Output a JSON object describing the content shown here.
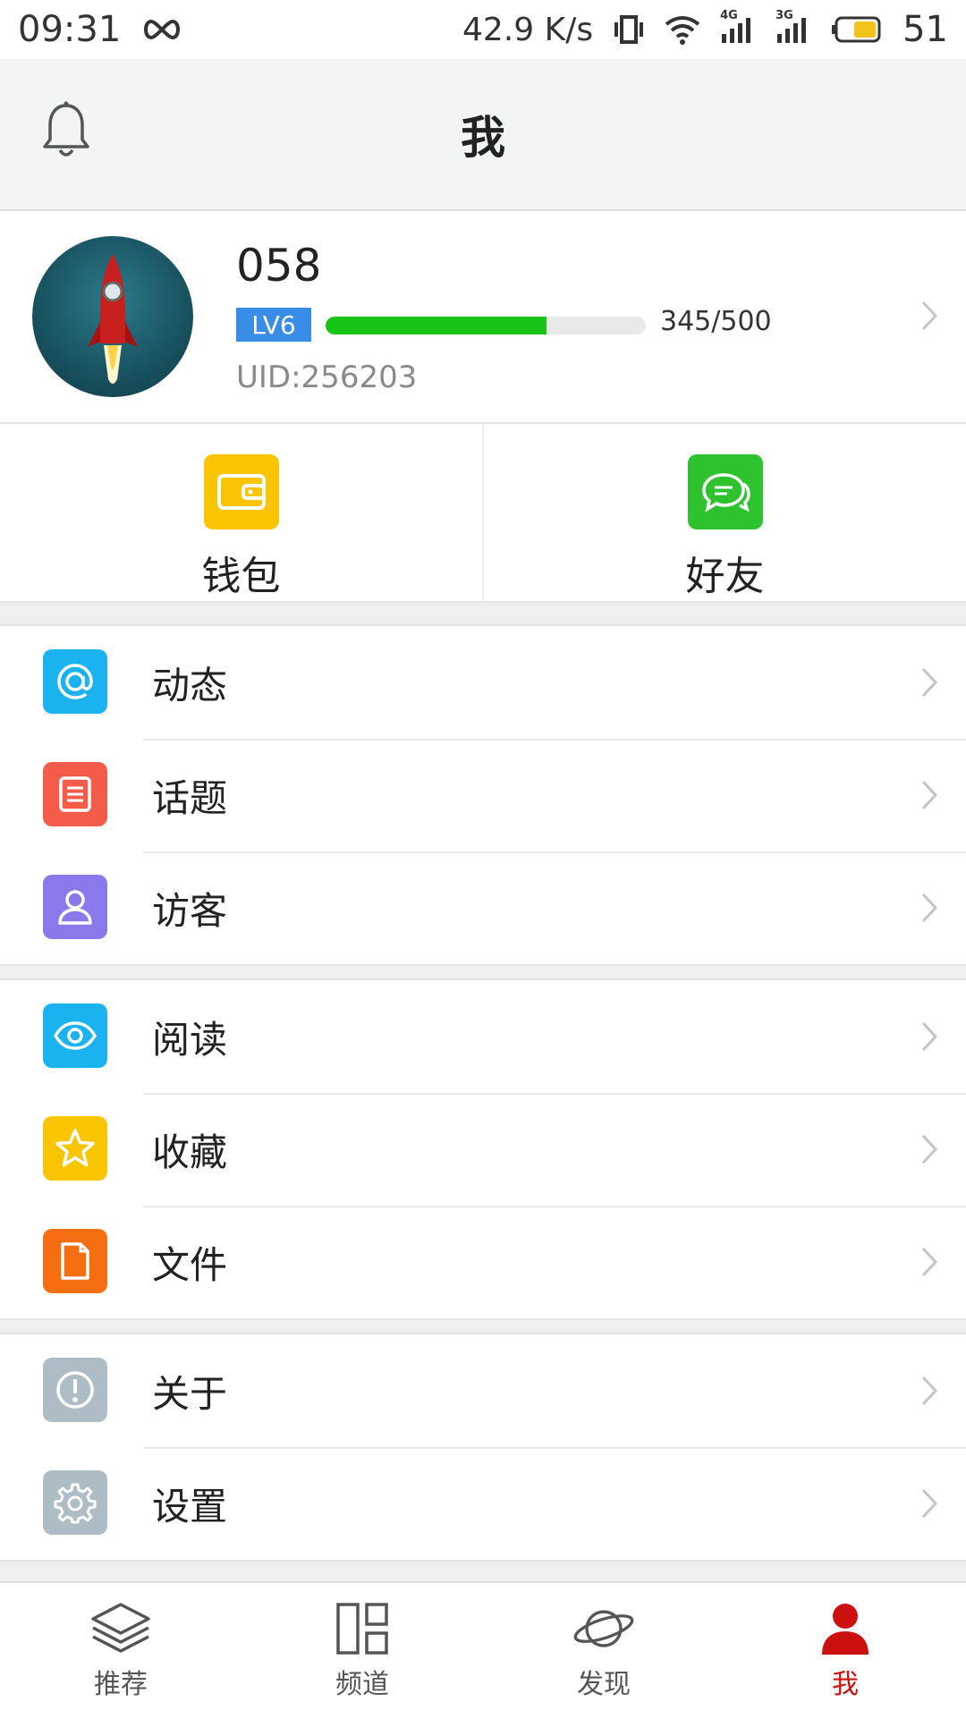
{
  "status_bar": {
    "time": "09:31",
    "net_speed": "42.9 K/s",
    "battery": "51",
    "net1": "4G",
    "net2": "3G"
  },
  "header": {
    "title": "我"
  },
  "profile": {
    "username": "058",
    "level_badge": "LV6",
    "xp_text": "345/500",
    "xp_fraction": 0.69,
    "uid_text": "UID:256203"
  },
  "quick_actions": [
    {
      "label": "钱包",
      "icon": "wallet-icon",
      "color": "#f9c400"
    },
    {
      "label": "好友",
      "icon": "chat-bubbles-icon",
      "color": "#2ec22e"
    }
  ],
  "menu_groups": [
    [
      {
        "label": "动态",
        "icon": "at-icon",
        "color": "#1ab3ef"
      },
      {
        "label": "话题",
        "icon": "list-icon",
        "color": "#f45c4a"
      },
      {
        "label": "访客",
        "icon": "person-icon",
        "color": "#8a79ea"
      }
    ],
    [
      {
        "label": "阅读",
        "icon": "eye-icon",
        "color": "#1ab3ef"
      },
      {
        "label": "收藏",
        "icon": "star-icon",
        "color": "#f9c400"
      },
      {
        "label": "文件",
        "icon": "file-icon",
        "color": "#f56f12"
      }
    ],
    [
      {
        "label": "关于",
        "icon": "info-icon",
        "color": "#aebcc6"
      },
      {
        "label": "设置",
        "icon": "gear-icon",
        "color": "#aebcc6"
      }
    ]
  ],
  "tabs": [
    {
      "label": "推荐",
      "icon": "layers-icon",
      "active": false
    },
    {
      "label": "频道",
      "icon": "grid-icon",
      "active": false
    },
    {
      "label": "发现",
      "icon": "planet-icon",
      "active": false
    },
    {
      "label": "我",
      "icon": "user-icon",
      "active": true
    }
  ],
  "colors": {
    "accent_red": "#cc1010",
    "level_blue": "#3a8de6",
    "xp_green": "#19c419"
  }
}
